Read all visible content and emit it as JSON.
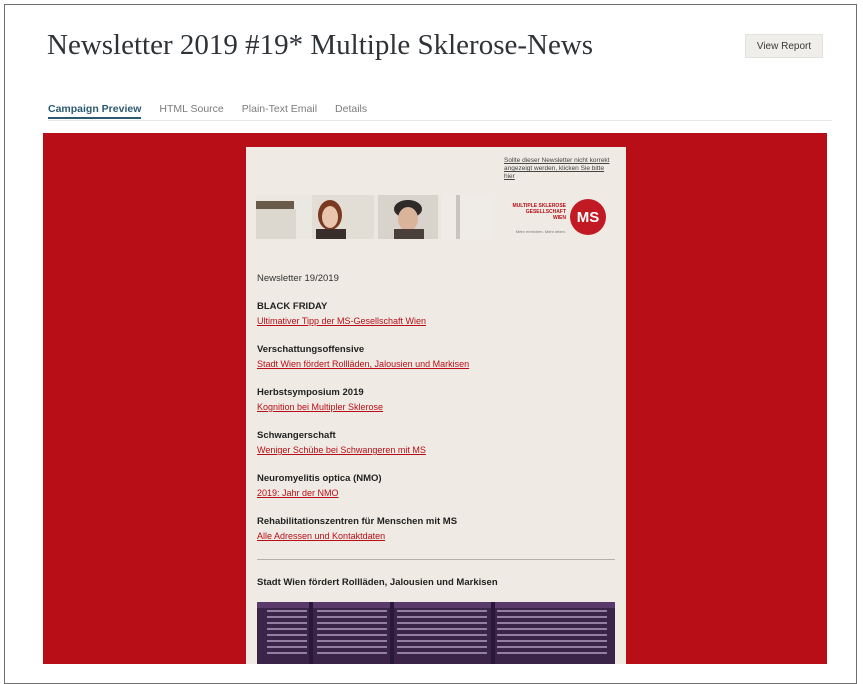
{
  "page": {
    "title": "Newsletter 2019 #19* Multiple Sklerose-News",
    "view_report_label": "View Report"
  },
  "tabs": [
    {
      "label": "Campaign Preview",
      "active": true
    },
    {
      "label": "HTML Source",
      "active": false
    },
    {
      "label": "Plain-Text Email",
      "active": false
    },
    {
      "label": "Details",
      "active": false
    }
  ],
  "colors": {
    "brand_red": "#b80e17",
    "email_bg": "#efebe4",
    "active_tab": "#2b5a70"
  },
  "email": {
    "webview_link": "Sollte dieser Newsletter nicht korrekt angezeigt werden, klicken Sie bitte hier",
    "logo": {
      "text_line1": "MULTIPLE SKLEROSE",
      "text_line2": "GESELLSCHAFT",
      "text_line3": "WIEN",
      "tagline": "Mehr erreichen. Mehr leben.",
      "badge": "MS"
    },
    "newsletter_label": "Newsletter 19/2019",
    "sections": [
      {
        "title": "BLACK FRIDAY",
        "link": "Ultimativer Tipp der MS-Gesellschaft Wien"
      },
      {
        "title": "Verschattungsoffensive",
        "link": "Stadt Wien fördert Rollläden, Jalousien und Markisen"
      },
      {
        "title": "Herbstsymposium 2019",
        "link": "Kognition bei Multipler Sklerose"
      },
      {
        "title": "Schwangerschaft",
        "link": "Weniger Schübe bei Schwangeren mit MS"
      },
      {
        "title": "Neuromyelitis optica (NMO)",
        "link": "2019: Jahr der NMO"
      },
      {
        "title": "Rehabilitationszentren für Menschen mit MS",
        "link": "Alle Adressen und Kontaktdaten"
      }
    ],
    "article_title": "Stadt Wien fördert Rollläden, Jalousien und Markisen"
  }
}
